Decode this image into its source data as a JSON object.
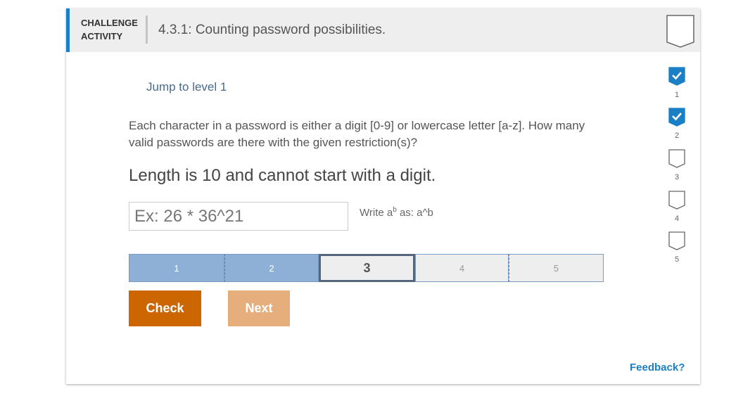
{
  "header": {
    "label_line1": "CHALLENGE",
    "label_line2": "ACTIVITY",
    "title": "4.3.1: Counting password possibilities."
  },
  "jump_link": "Jump to level 1",
  "question": "Each character in a password is either a digit [0-9] or lowercase letter [a-z]. How many valid passwords are there with the given restriction(s)?",
  "prompt": "Length is 10 and cannot start with a digit.",
  "answer": {
    "value": "",
    "placeholder": "Ex: 26 * 36^21"
  },
  "hint": {
    "prefix": "Write a",
    "superscript": "b",
    "suffix": " as: a^b"
  },
  "levels": [
    {
      "label": "1",
      "state": "done"
    },
    {
      "label": "2",
      "state": "done"
    },
    {
      "label": "3",
      "state": "current"
    },
    {
      "label": "4",
      "state": "todo"
    },
    {
      "label": "5",
      "state": "todo"
    }
  ],
  "buttons": {
    "check": "Check",
    "next": "Next"
  },
  "feedback": "Feedback?",
  "sidebar": [
    {
      "num": "1",
      "completed": true
    },
    {
      "num": "2",
      "completed": true
    },
    {
      "num": "3",
      "completed": false
    },
    {
      "num": "4",
      "completed": false
    },
    {
      "num": "5",
      "completed": false
    }
  ],
  "colors": {
    "accent": "#1a7fc4",
    "check_button": "#cc6600",
    "next_button": "#e6ae7d",
    "level_done": "#8eb0d6"
  }
}
